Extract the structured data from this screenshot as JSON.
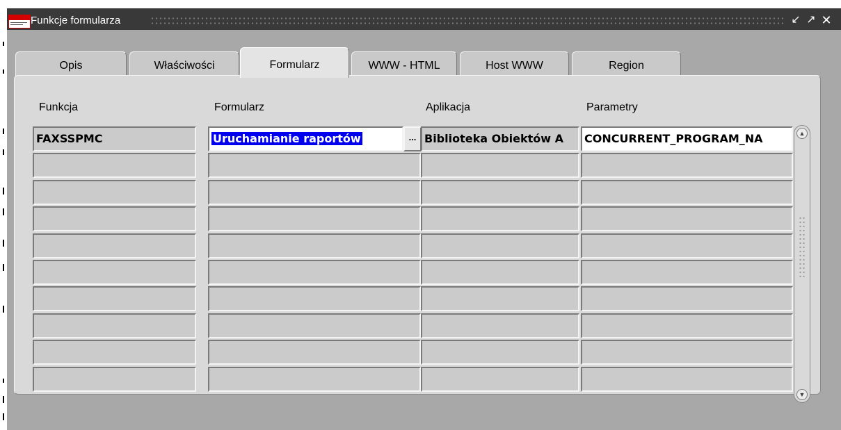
{
  "window": {
    "title": "Funkcje formularza",
    "controls": {
      "minimize_icon": "↙",
      "maximize_icon": "↗",
      "close_icon": "✕"
    }
  },
  "tabs": [
    {
      "label": "Opis",
      "active": false
    },
    {
      "label": "Właściwości",
      "active": false
    },
    {
      "label": "Formularz",
      "active": true
    },
    {
      "label": "WWW - HTML",
      "active": false
    },
    {
      "label": "Host WWW",
      "active": false
    },
    {
      "label": "Region",
      "active": false
    }
  ],
  "grid": {
    "headers": {
      "funkcja": "Funkcja",
      "formularz": "Formularz",
      "aplikacja": "Aplikacja",
      "parametry": "Parametry"
    },
    "rows": [
      {
        "funkcja": "FAXSSPMC",
        "formularz": "Uruchamianie raportów",
        "aplikacja": "Biblioteka Obiektów A",
        "parametry": "CONCURRENT_PROGRAM_NA"
      },
      {
        "funkcja": "",
        "formularz": "",
        "aplikacja": "",
        "parametry": ""
      },
      {
        "funkcja": "",
        "formularz": "",
        "aplikacja": "",
        "parametry": ""
      },
      {
        "funkcja": "",
        "formularz": "",
        "aplikacja": "",
        "parametry": ""
      },
      {
        "funkcja": "",
        "formularz": "",
        "aplikacja": "",
        "parametry": ""
      },
      {
        "funkcja": "",
        "formularz": "",
        "aplikacja": "",
        "parametry": ""
      },
      {
        "funkcja": "",
        "formularz": "",
        "aplikacja": "",
        "parametry": ""
      },
      {
        "funkcja": "",
        "formularz": "",
        "aplikacja": "",
        "parametry": ""
      },
      {
        "funkcja": "",
        "formularz": "",
        "aplikacja": "",
        "parametry": ""
      },
      {
        "funkcja": "",
        "formularz": "",
        "aplikacja": "",
        "parametry": ""
      }
    ],
    "lov_button_label": "..."
  },
  "colors": {
    "titlebar": "#393939",
    "window_bg": "#a8a8a8",
    "panel_bg": "#d9d9d9",
    "selection": "#0000ee"
  }
}
